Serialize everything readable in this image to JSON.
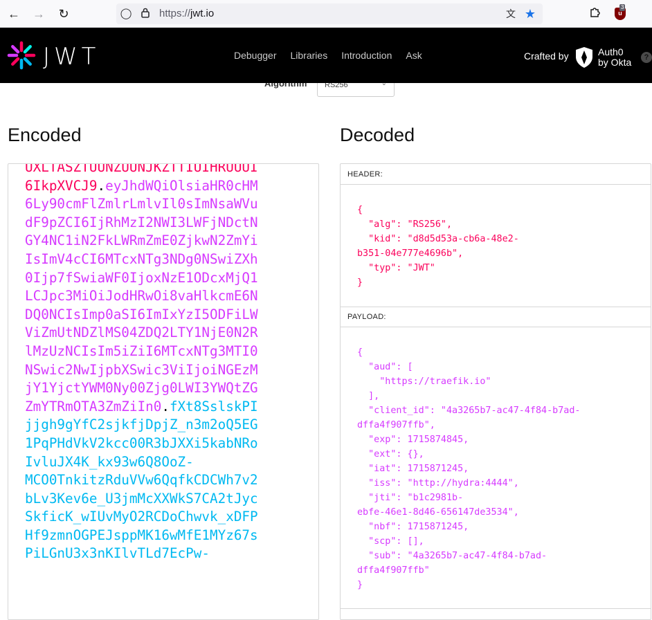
{
  "browser": {
    "url_scheme": "https://",
    "url_host": "jwt.io",
    "extension_badge": "3"
  },
  "site": {
    "logo_text": "JWT",
    "nav": [
      "Debugger",
      "Libraries",
      "Introduction",
      "Ask"
    ],
    "crafted_by": "Crafted by",
    "brand_line1": "Auth0",
    "brand_line2": "by Okta",
    "help": "?"
  },
  "algorithm": {
    "label": "Algorithm",
    "value": "RS256"
  },
  "encoded": {
    "title": "Encoded",
    "lines": [
      [
        {
          "t": "UXLTASZTUUNZUUNJKZTTIUIHRUUUI",
          "c": "h"
        }
      ],
      [
        {
          "t": "6IkpXVCJ9",
          "c": "h"
        },
        {
          "t": ".",
          "c": "d"
        },
        {
          "t": "eyJhdWQiOlsiaHR0cHM",
          "c": "p"
        }
      ],
      [
        {
          "t": "6Ly90cmFlZmlrLmlvIl0sImNsaWVu",
          "c": "p"
        }
      ],
      [
        {
          "t": "dF9pZCI6IjRhMzI2NWI3LWFjNDctN",
          "c": "p"
        }
      ],
      [
        {
          "t": "GY4NC1iN2FkLWRmZmE0ZjkwN2ZmYi",
          "c": "p"
        }
      ],
      [
        {
          "t": "IsImV4cCI6MTcxNTg3NDg0NSwiZXh",
          "c": "p"
        }
      ],
      [
        {
          "t": "0Ijp7fSwiaWF0IjoxNzE1ODcxMjQ1",
          "c": "p"
        }
      ],
      [
        {
          "t": "LCJpc3MiOiJodHRwOi8vaHlkcmE6N",
          "c": "p"
        }
      ],
      [
        {
          "t": "DQ0NCIsImp0aSI6ImIxYzI5ODFiLW",
          "c": "p"
        }
      ],
      [
        {
          "t": "ViZmUtNDZlMS04ZDQ2LTY1NjE0N2R",
          "c": "p"
        }
      ],
      [
        {
          "t": "lMzUzNCIsIm5iZiI6MTcxNTg3MTI0",
          "c": "p"
        }
      ],
      [
        {
          "t": "NSwic2NwIjpbXSwic3ViIjoiNGEzM",
          "c": "p"
        }
      ],
      [
        {
          "t": "jY1YjctYWM0Ny00Zjg0LWI3YWQtZG",
          "c": "p"
        }
      ],
      [
        {
          "t": "ZmYTRmOTA3ZmZiIn0",
          "c": "p"
        },
        {
          "t": ".",
          "c": "d"
        },
        {
          "t": "fXt8SslskPI",
          "c": "s"
        }
      ],
      [
        {
          "t": "jjgh9gYfC2sjkfjDpjZ_n3m2oQ5EG",
          "c": "s"
        }
      ],
      [
        {
          "t": "1PqPHdVkV2kcc00R3bJXXi5kabNRo",
          "c": "s"
        }
      ],
      [
        {
          "t": "IvluJX4K_kx93w6Q8OoZ-",
          "c": "s"
        }
      ],
      [
        {
          "t": "MCO0TnkitzRduVVw6QqfkCDCWh7v2",
          "c": "s"
        }
      ],
      [
        {
          "t": "bLv3Kev6e_U3jmMcXXWkS7CA2tJyc",
          "c": "s"
        }
      ],
      [
        {
          "t": "SkficK_wIUvMyO2RCDoChwvk_xDFP",
          "c": "s"
        }
      ],
      [
        {
          "t": "Hf9zmnOGPEJsppMK16wMfE1MYz67s",
          "c": "s"
        }
      ],
      [
        {
          "t": "PiLGnU3x3nKIlvTLd7EcPw-",
          "c": "s"
        }
      ]
    ]
  },
  "decoded": {
    "title": "Decoded",
    "header_title": "HEADER:",
    "header_json": [
      "{",
      "  \"alg\": \"RS256\",",
      "  \"kid\": \"d8d5d53a-cb6a-48e2-",
      "b351-04e777e4696b\",",
      "  \"typ\": \"JWT\"",
      "}"
    ],
    "payload_title": "PAYLOAD:",
    "payload_json": [
      "{",
      "  \"aud\": [",
      "    \"https://traefik.io\"",
      "  ],",
      "  \"client_id\": \"4a3265b7-ac47-4f84-b7ad-",
      "dffa4f907ffb\",",
      "  \"exp\": 1715874845,",
      "  \"ext\": {},",
      "  \"iat\": 1715871245,",
      "  \"iss\": \"http://hydra:4444\",",
      "  \"jti\": \"b1c2981b-",
      "ebfe-46e1-8d46-656147de3534\",",
      "  \"nbf\": 1715871245,",
      "  \"scp\": [],",
      "  \"sub\": \"4a3265b7-ac47-4f84-b7ad-",
      "dffa4f907ffb\"",
      "}"
    ]
  }
}
